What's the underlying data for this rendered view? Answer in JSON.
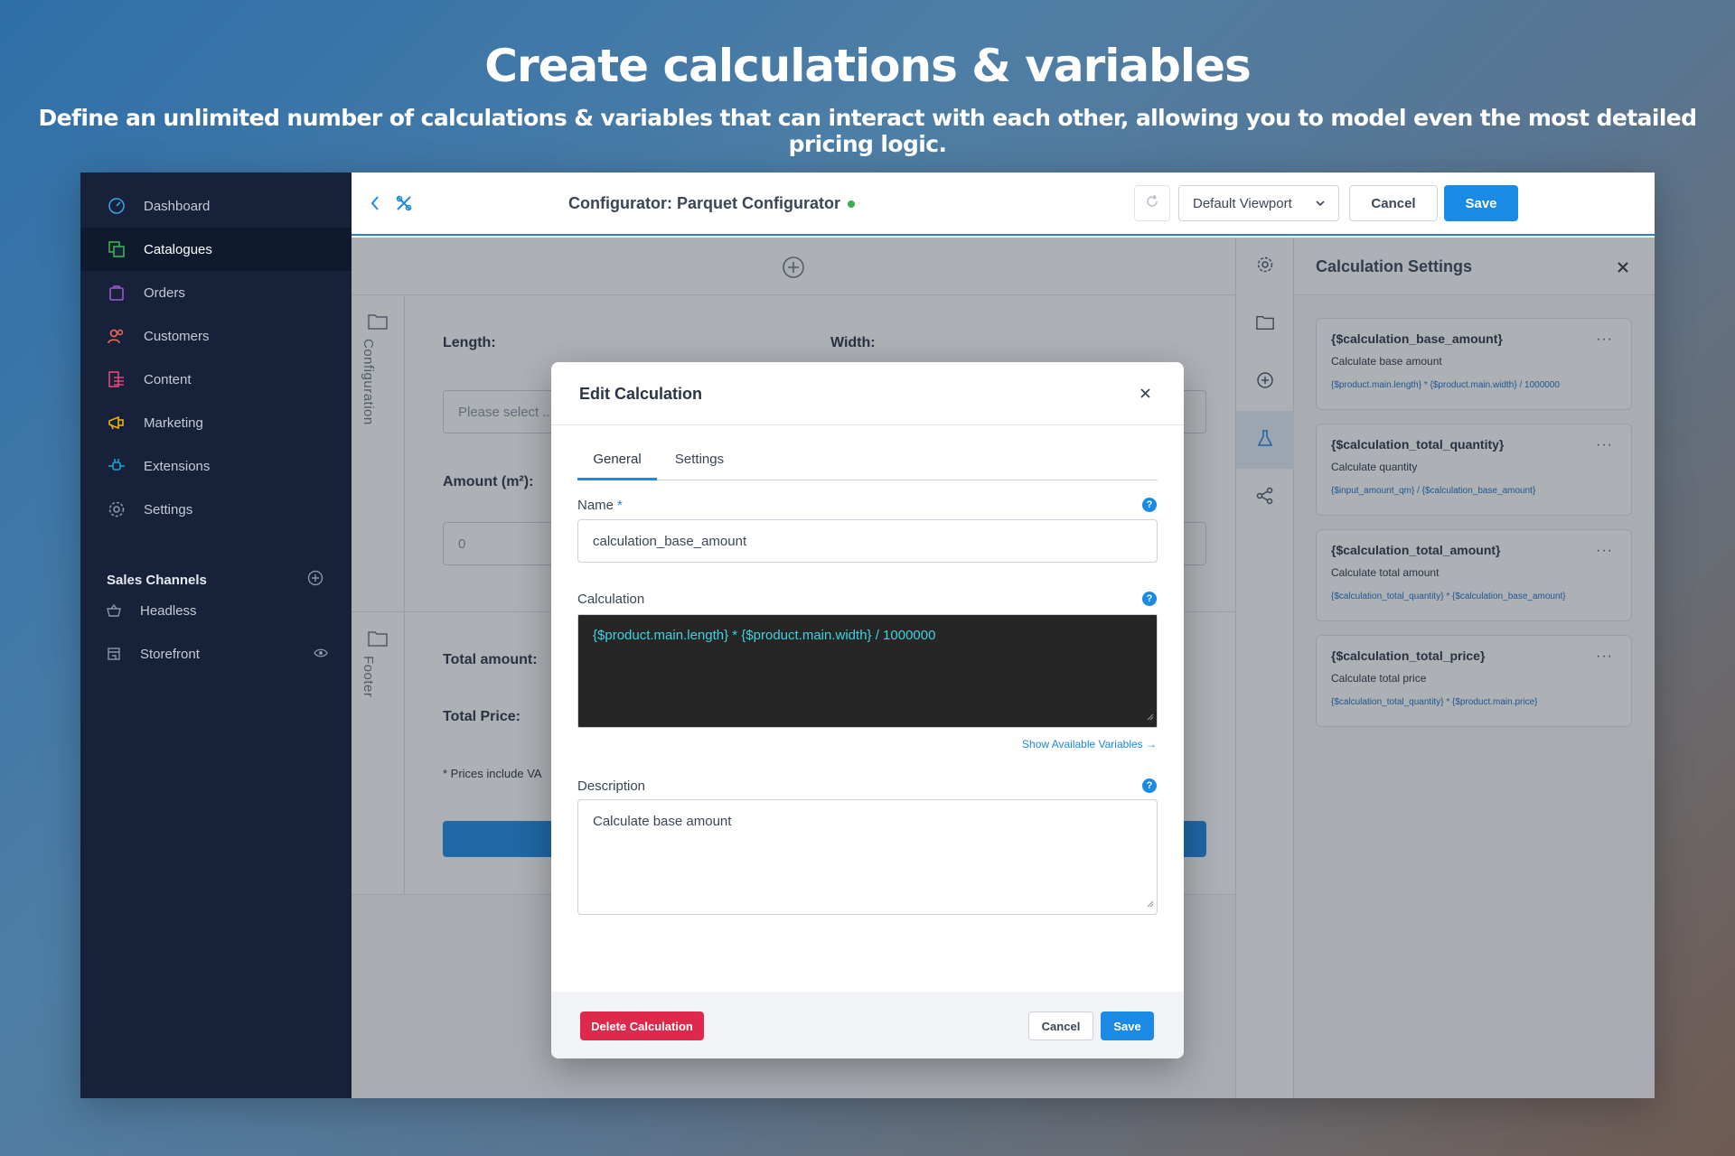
{
  "hero": {
    "title": "Create calculations & variables",
    "subtitle": "Define an unlimited number of calculations & variables that can interact with each other, allowing you to model even the most detailed pricing logic."
  },
  "sidebar": {
    "items": [
      {
        "label": "Dashboard",
        "icon": "gauge-icon",
        "color": "#3aa0e0"
      },
      {
        "label": "Catalogues",
        "icon": "layers-icon",
        "color": "#37b24d"
      },
      {
        "label": "Orders",
        "icon": "bag-icon",
        "color": "#9b59d0"
      },
      {
        "label": "Customers",
        "icon": "users-icon",
        "color": "#f06a5a"
      },
      {
        "label": "Content",
        "icon": "content-icon",
        "color": "#e0457a"
      },
      {
        "label": "Marketing",
        "icon": "megaphone-icon",
        "color": "#f0b400"
      },
      {
        "label": "Extensions",
        "icon": "plug-icon",
        "color": "#1aa4d8"
      },
      {
        "label": "Settings",
        "icon": "gear-icon",
        "color": "#8b95a3"
      }
    ],
    "sales_channels": {
      "title": "Sales Channels",
      "items": [
        {
          "label": "Headless",
          "icon": "basket-icon"
        },
        {
          "label": "Storefront",
          "icon": "storefront-icon"
        }
      ]
    }
  },
  "topbar": {
    "title": "Configurator: Parquet Configurator",
    "viewport": "Default Viewport",
    "cancel": "Cancel",
    "save": "Save"
  },
  "canvas": {
    "config_section": "Configuration",
    "footer_section": "Footer",
    "length_label": "Length:",
    "width_label": "Width:",
    "select_placeholder": "Please select ...",
    "amount_label": "Amount (m²):",
    "amount_value": "0",
    "total_amount_label": "Total amount:",
    "total_price_label": "Total Price:",
    "prices_note": "* Prices include VA"
  },
  "calc_panel": {
    "title": "Calculation Settings",
    "cards": [
      {
        "name": "{$calculation_base_amount}",
        "desc": "Calculate base amount",
        "formula": "{$product.main.length} * {$product.main.width} / 1000000"
      },
      {
        "name": "{$calculation_total_quantity}",
        "desc": "Calculate quantity",
        "formula": "{$input_amount_qm} / {$calculation_base_amount}"
      },
      {
        "name": "{$calculation_total_amount}",
        "desc": "Calculate total amount",
        "formula": "{$calculation_total_quantity} * {$calculation_base_amount}"
      },
      {
        "name": "{$calculation_total_price}",
        "desc": "Calculate total price",
        "formula": "{$calculation_total_quantity} * {$product.main.price}"
      }
    ]
  },
  "modal": {
    "title": "Edit Calculation",
    "tabs": [
      "General",
      "Settings"
    ],
    "name_label": "Name",
    "name_required": "*",
    "name_value": "calculation_base_amount",
    "calculation_label": "Calculation",
    "calculation_value": "{$product.main.length} * {$product.main.width} / 1000000",
    "show_variables": "Show Available Variables →",
    "description_label": "Description",
    "description_value": "Calculate base amount",
    "help_glyph": "?",
    "delete": "Delete Calculation",
    "cancel": "Cancel",
    "save": "Save"
  },
  "colors": {
    "accent": "#1a8ae5",
    "danger": "#de294c",
    "sidebar_bg": "#17223a",
    "code_bg": "#262626",
    "code_text": "#3fd3e0",
    "online": "#37b24d"
  }
}
